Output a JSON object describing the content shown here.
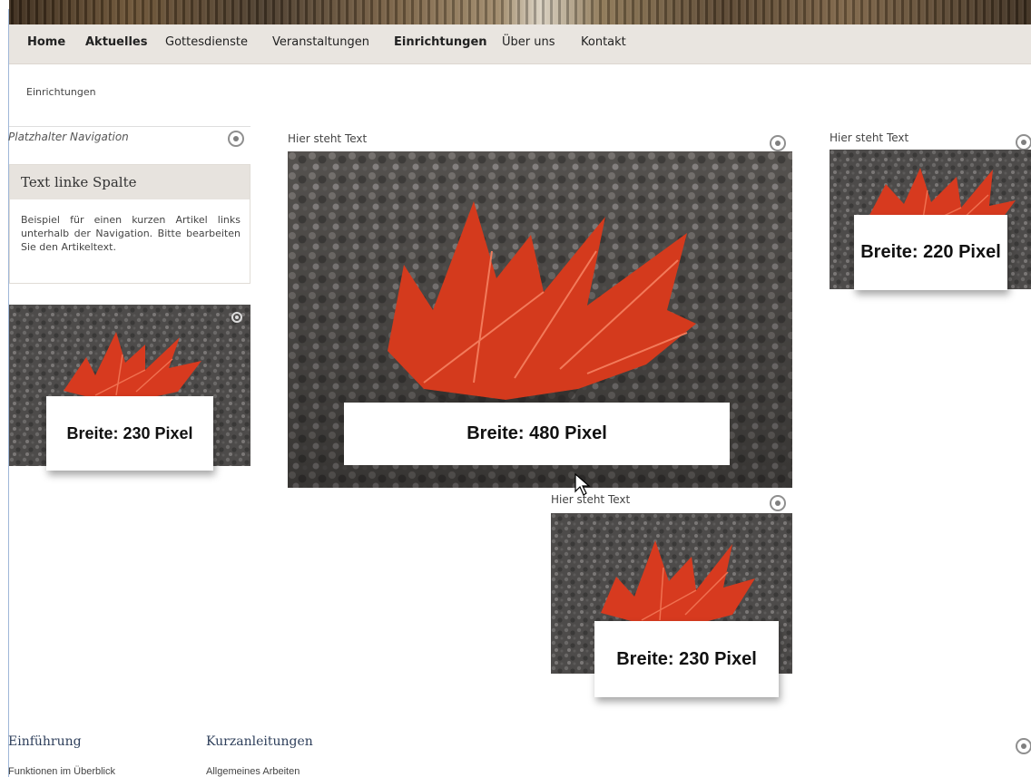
{
  "nav": {
    "items": [
      "Home",
      "Aktuelles",
      "Gottesdienste",
      "Veranstaltungen",
      "Einrichtungen",
      "Über uns",
      "Kontakt"
    ]
  },
  "breadcrumb": "Einrichtungen",
  "left": {
    "placeholder_nav": "Platzhalter Navigation",
    "box_title": "Text linke Spalte",
    "box_text": "Beispiel für einen kurzen Artikel links unterhalb der Navigation. Bitte bearbeiten Sie den Artikeltext.",
    "image_label": "Breite: 230 Pixel"
  },
  "main": {
    "caption": "Hier steht Text",
    "image_label": "Breite: 480 Pixel"
  },
  "lower": {
    "caption": "Hier steht Text",
    "image_label": "Breite: 230 Pixel"
  },
  "right": {
    "caption": "Hier steht Text",
    "image_label": "Breite: 220 Pixel"
  },
  "footer": {
    "col1_heading": "Einführung",
    "col1_link": "Funktionen im Überblick",
    "col2_heading": "Kurzanleitungen",
    "col2_link": "Allgemeines Arbeiten"
  },
  "icons": [
    "settings-icon",
    "mouse-cursor-icon"
  ],
  "colors": {
    "nav_bg": "#e9e5e0",
    "leaf_red": "#d8381c",
    "footer_heading": "#2d3e5a"
  }
}
